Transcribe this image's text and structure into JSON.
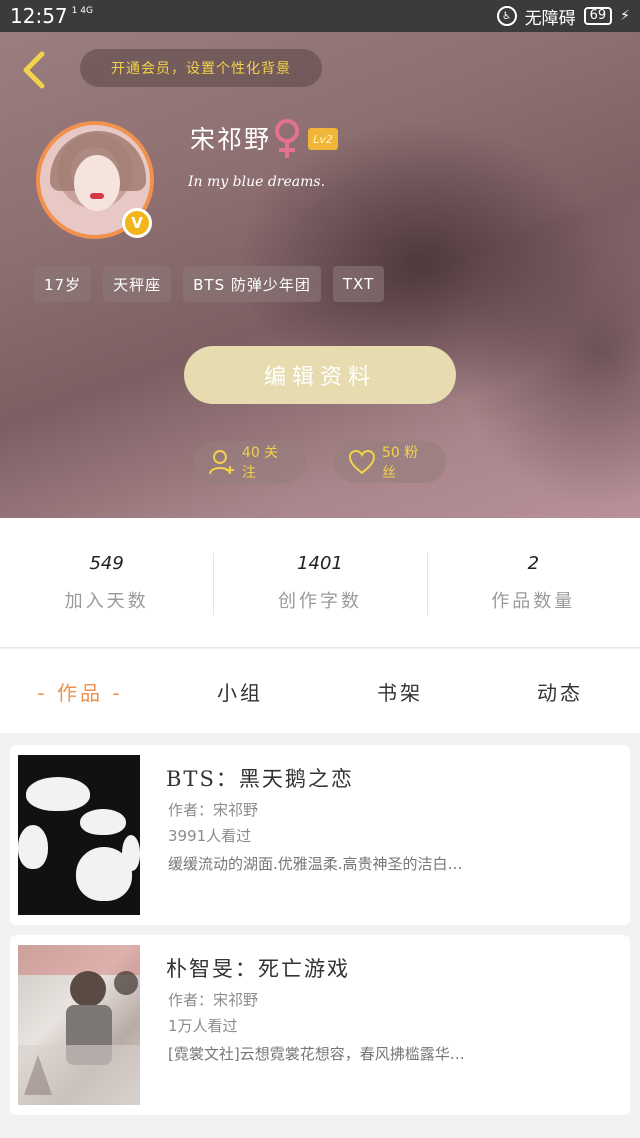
{
  "status_bar": {
    "time": "12:57",
    "network": "1 4G",
    "accessibility_label": "无障碍",
    "battery": "69"
  },
  "header": {
    "vip_banner": "开通会员，设置个性化背景",
    "username": "宋祁野",
    "level": "Lv2",
    "bio": "In my blue dreams.",
    "tags": [
      "17岁",
      "天秤座",
      "BTS 防弹少年团",
      "TXT"
    ],
    "edit_button": "编辑资料",
    "following": "40 关注",
    "fans": "50 粉丝",
    "accent_color": "#f0924e",
    "vip_text_color": "#f2d24a"
  },
  "stats": [
    {
      "value": "549",
      "label": "加入天数"
    },
    {
      "value": "1401",
      "label": "创作字数"
    },
    {
      "value": "2",
      "label": "作品数量"
    }
  ],
  "tabs": [
    "- 作品 -",
    "小组",
    "书架",
    "动态"
  ],
  "works": [
    {
      "title": "BTS：黑天鹅之恋",
      "author": "作者：宋祁野",
      "views": "3991人看过",
      "desc": "缓缓流动的湖面.优雅温柔.高贵神圣的洁白…"
    },
    {
      "title": "朴智旻：死亡游戏",
      "author": "作者：宋祁野",
      "views": "1万人看过",
      "desc": "[霓裳文社]云想霓裳花想容，春风拂槛露华…"
    }
  ]
}
